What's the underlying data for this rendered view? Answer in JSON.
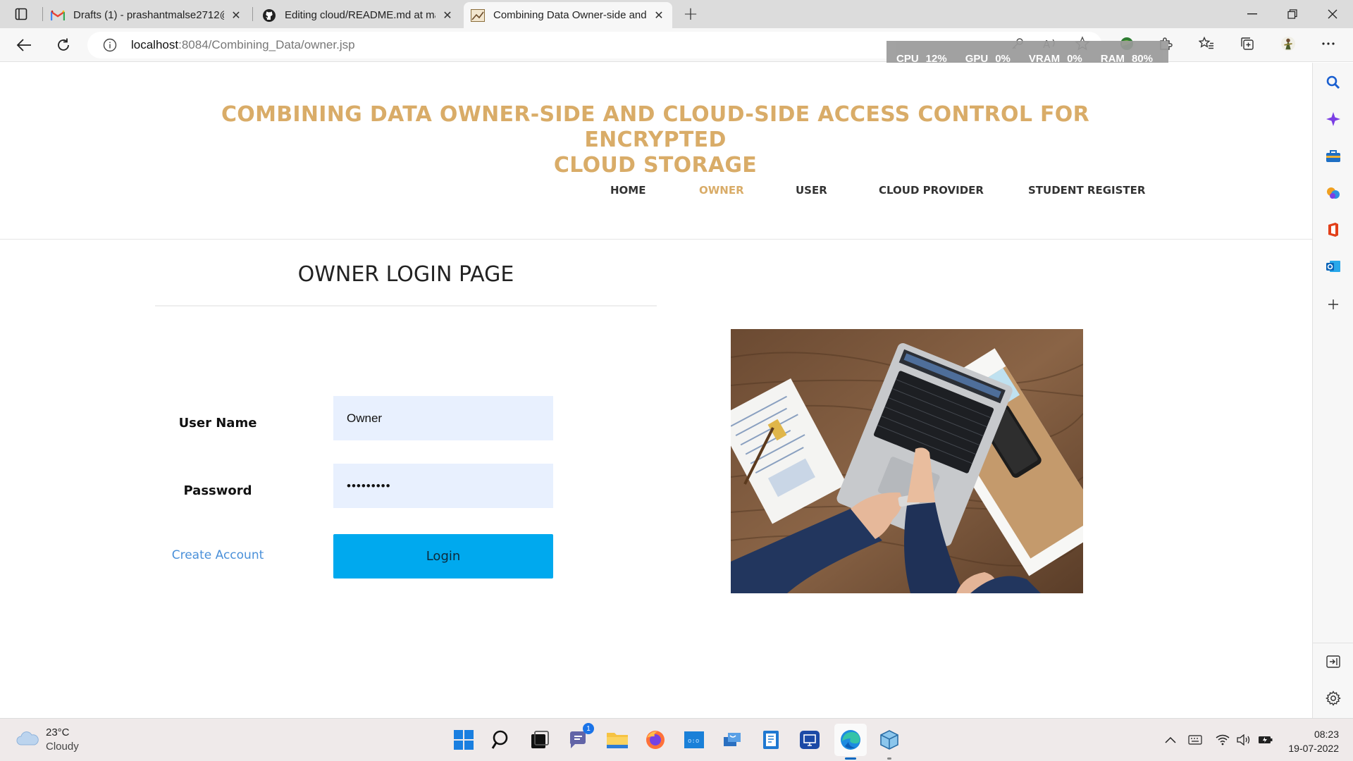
{
  "browser": {
    "tabs": [
      {
        "title": "Drafts (1) - prashantmalse2712@",
        "icon": "gmail-icon"
      },
      {
        "title": "Editing cloud/README.md at ma",
        "icon": "github-icon"
      },
      {
        "title": "Combining Data Owner-side and",
        "icon": "page-favicon"
      }
    ],
    "active_tab": 2,
    "address": {
      "host": "localhost",
      "path": ":8084/Combining_Data/owner.jsp"
    },
    "perf": {
      "cpu_label": "CPU",
      "cpu": "12%",
      "gpu_label": "GPU",
      "gpu": "0%",
      "vram_label": "VRAM",
      "vram": "0%",
      "ram_label": "RAM",
      "ram": "80%"
    }
  },
  "site": {
    "title_line1": "COMBINING DATA OWNER-SIDE AND CLOUD-SIDE ACCESS CONTROL FOR ENCRYPTED",
    "title_line2": "CLOUD STORAGE",
    "nav": [
      "HOME",
      "OWNER",
      "USER",
      "CLOUD PROVIDER",
      "STUDENT REGISTER"
    ],
    "active_nav": "OWNER",
    "accent_color": "#d9ac68"
  },
  "login": {
    "heading": "OWNER LOGIN PAGE",
    "username_label": "User Name",
    "username_value": "Owner",
    "password_label": "Password",
    "password_value": "•••••••••",
    "create_account": "Create Account",
    "login_button": "Login",
    "button_color": "#00a9ee"
  },
  "taskbar": {
    "weather_temp": "23°C",
    "weather_cond": "Cloudy",
    "teams_badge": "1",
    "time": "08:23",
    "date": "19-07-2022"
  }
}
